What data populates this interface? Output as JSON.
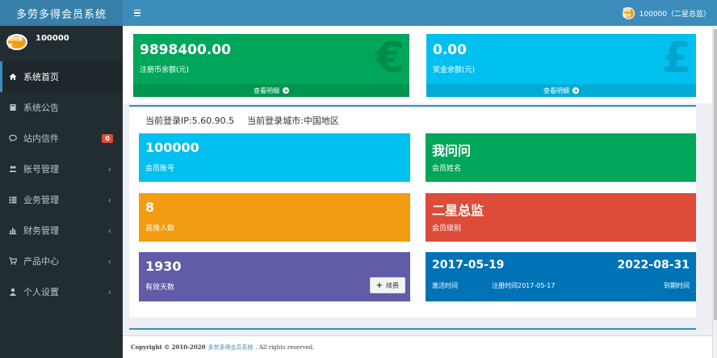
{
  "app": {
    "title": "多劳多得会员系统"
  },
  "header": {
    "user_label": "100000（二星总监）",
    "avatar_text": "理财服务"
  },
  "sidebar": {
    "user_name": "100000",
    "items": [
      {
        "label": "系统首页",
        "icon": "home-icon"
      },
      {
        "label": "系统公告",
        "icon": "book-icon"
      },
      {
        "label": "站内信件",
        "icon": "comment-icon",
        "badge": "0"
      },
      {
        "label": "账号管理",
        "icon": "users-icon"
      },
      {
        "label": "业务管理",
        "icon": "list-icon"
      },
      {
        "label": "财务管理",
        "icon": "bar-chart-icon"
      },
      {
        "label": "产品中心",
        "icon": "cart-icon"
      },
      {
        "label": "个人设置",
        "icon": "user-icon"
      }
    ],
    "chevron": "‹"
  },
  "top_cards": {
    "registered_balance": {
      "value": "9898400.00",
      "label": "注册币余额(元)",
      "link": "查看明细",
      "icon_glyph": "€",
      "color": "#00a65a"
    },
    "bonus_balance": {
      "value": "0.00",
      "label": "奖金余额(元)",
      "link": "查看明细",
      "icon_glyph": "£",
      "color": "#00c0ef"
    }
  },
  "login_info": {
    "ip": "当前登录IP:5.60.90.5",
    "city": "当前登录城市:中国地区"
  },
  "info_boxes": {
    "account": {
      "value": "100000",
      "label": "会员账号"
    },
    "name": {
      "value": "我问问",
      "label": "会员姓名"
    },
    "direct": {
      "value": "8",
      "label": "直推人数"
    },
    "level": {
      "value": "二星总监",
      "label": "会员级别"
    },
    "valid_days": {
      "value": "1930",
      "label": "有效天数",
      "button": "续费"
    },
    "dates": {
      "activate_date": "2017-05-19",
      "activate_label": "激活时间",
      "register_label": "注册时间2017-05-17",
      "expire_date": "2022-08-31",
      "expire_label": "到期时间"
    }
  },
  "footer": {
    "prefix": "Copyright © 2010-2020",
    "link": "多劳多得会员系统",
    "suffix": ". All rights reserved."
  },
  "colors": {
    "header": "#3c8dbc",
    "logo": "#367fa9",
    "sidebar": "#222d32"
  }
}
